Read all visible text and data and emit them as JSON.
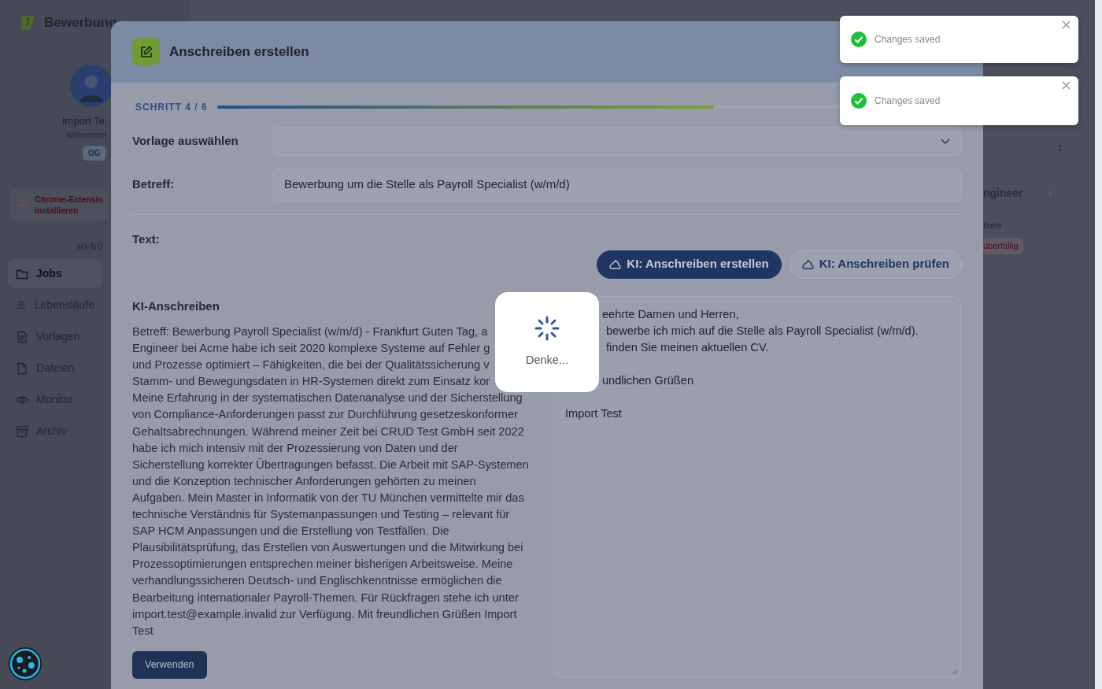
{
  "app": {
    "brand": "Bewerbung",
    "profile": {
      "name": "Import Te",
      "subtitle": "Willkomme",
      "badge": "OG"
    },
    "extension": [
      "Chrome-Extensio",
      "installieren"
    ],
    "menu_heading": "MENÜ",
    "nav": [
      {
        "label": "Jobs",
        "selected": true
      },
      {
        "label": "Lebensläufe",
        "selected": false
      },
      {
        "label": "Vorlagen",
        "selected": false
      },
      {
        "label": "Dateien",
        "selected": false
      },
      {
        "label": "Monitor",
        "selected": false
      },
      {
        "label": "Archiv",
        "selected": false
      }
    ]
  },
  "background": {
    "count": "1",
    "job_title": "ngineer",
    "job_subtitle": "tions",
    "status": "überfällig"
  },
  "modal": {
    "title": "Anschreiben erstellen",
    "step": "SCHRITT 4 / 6",
    "level": 0.667,
    "template": {
      "label": "Vorlage auswählen"
    },
    "subject": {
      "label": "Betreff:",
      "value": "Bewerbung um die Stelle als Payroll Specialist (w/m/d)"
    },
    "text_label": "Text:",
    "buttons": [
      {
        "label": "KI: Anschreiben erstellen",
        "kind": "primary"
      },
      {
        "label": "KI: Anschreiben prüfen",
        "kind": "outline"
      }
    ],
    "ai_letter": {
      "heading": "KI-Anschreiben",
      "lines": [
        "Betreff: Bewerbung Payroll Specialist (w/m/d) - Frankfurt Guten Tag, a",
        "Engineer bei Acme habe ich seit 2020 komplexe Systeme auf Fehler g",
        "und Prozesse optimiert – Fähigkeiten, die bei der Qualitätssicherung v",
        "Stamm- und Bewegungsdaten in HR-Systemen direkt zum Einsatz kor",
        "Meine Erfahrung in der systematischen Datenanalyse und der Sicherstellung",
        "von Compliance-Anforderungen passt zur Durchführung gesetzeskonformer",
        "Gehaltsabrechnungen. Während meiner Zeit bei CRUD Test GmbH seit 2022",
        "habe ich mich intensiv mit der Prozessierung von Daten und der",
        "Sicherstellung korrekter Übertragungen befasst. Die Arbeit mit SAP-Systemen",
        "und die Konzeption technischer Anforderungen gehörten zu meinen",
        "Aufgaben. Mein Master in Informatik von der TU München vermittelte mir das",
        "technische Verständnis für Systemanpassungen und Testing – relevant für",
        "SAP HCM Anpassungen und die Erstellung von Testfällen. Die",
        "Plausibilitätsprüfung, das Erstellen von Auswertungen und die Mitwirkung bei",
        "Prozessoptimierungen entsprechen meiner bisherigen Arbeitsweise. Meine",
        "verhandlungssicheren Deutsch- und Englischkenntnisse ermöglichen die",
        "Bearbeitung internationaler Payroll-Themen. Für Rückfragen stehe ich unter",
        "import.test@example.invalid zur Verfügung. Mit freundlichen Grüßen Import",
        "Test"
      ],
      "button": "Verwenden"
    },
    "editor": [
      {
        "covered": true,
        "lines": [
          "eehrte Damen und Herren,",
          "bewerbe ich mich auf die Stelle als Payroll Specialist (w/m/d).",
          "finden Sie meinen aktuellen CV."
        ]
      },
      {
        "covered": true,
        "lines": [
          "undlichen Grüßen"
        ]
      },
      {
        "covered": false,
        "lines": [
          "Import Test"
        ]
      }
    ],
    "loading": {
      "text": "Denke..."
    }
  },
  "toasts": [
    {
      "text": "Changes saved"
    },
    {
      "text": "Changes saved"
    }
  ]
}
